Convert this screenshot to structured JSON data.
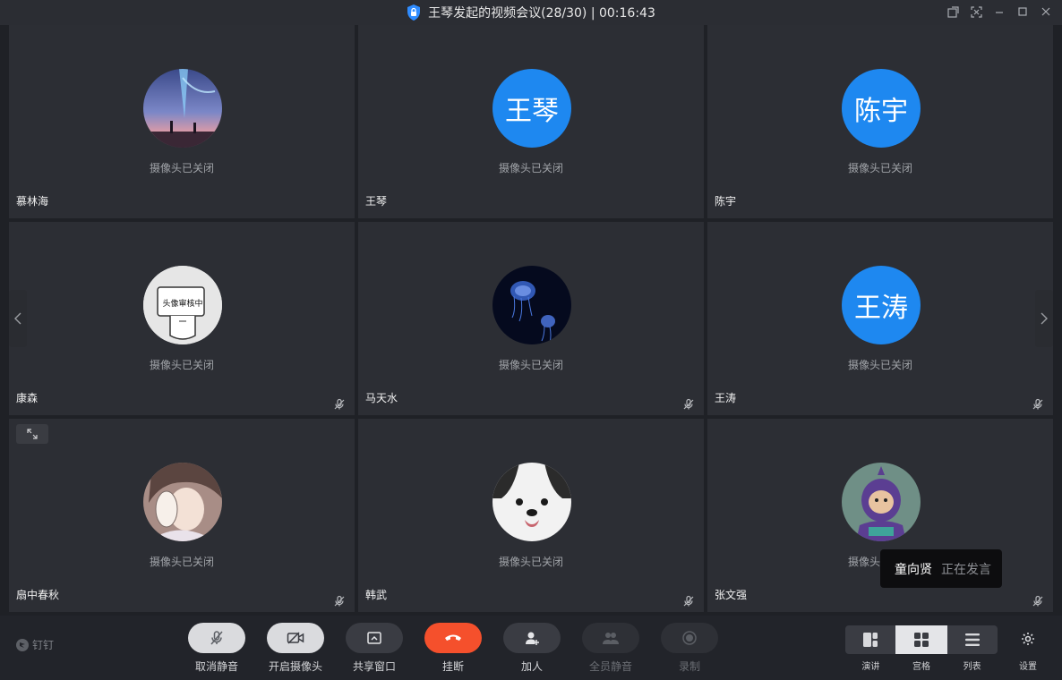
{
  "window": {
    "title": "王琴发起的视频会议(28/30) | 00:16:43"
  },
  "participants": [
    {
      "name": "慕林海",
      "camera_status": "摄像头已关闭",
      "avatar_type": "image",
      "avatar_desc": "anime-sky-avatar",
      "muted": false
    },
    {
      "name": "王琴",
      "camera_status": "摄像头已关闭",
      "avatar_type": "text",
      "avatar_text": "王琴",
      "muted": false
    },
    {
      "name": "陈宇",
      "camera_status": "摄像头已关闭",
      "avatar_type": "text",
      "avatar_text": "陈宇",
      "muted": false
    },
    {
      "name": "康森",
      "camera_status": "摄像头已关闭",
      "avatar_type": "image",
      "avatar_desc": "review-pending-avatar",
      "avatar_overlay": "头像审核中",
      "muted": true
    },
    {
      "name": "马天水",
      "camera_status": "摄像头已关闭",
      "avatar_type": "image",
      "avatar_desc": "jellyfish-avatar",
      "muted": true
    },
    {
      "name": "王涛",
      "camera_status": "摄像头已关闭",
      "avatar_type": "text",
      "avatar_text": "王涛",
      "muted": true
    },
    {
      "name": "扇中春秋",
      "camera_status": "摄像头已关闭",
      "avatar_type": "image",
      "avatar_desc": "anime-character-avatar",
      "muted": true
    },
    {
      "name": "韩武",
      "camera_status": "摄像头已关闭",
      "avatar_type": "image",
      "avatar_desc": "puppy-avatar",
      "muted": true
    },
    {
      "name": "张文强",
      "camera_status": "摄像头已关闭",
      "avatar_type": "image",
      "avatar_desc": "teletubby-avatar",
      "muted": true
    }
  ],
  "speaking": {
    "name": "童向贤",
    "status": "正在发言"
  },
  "toolbar": {
    "brand": "钉钉",
    "buttons": [
      {
        "label": "取消静音",
        "icon": "mic-muted-icon",
        "style": "light"
      },
      {
        "label": "开启摄像头",
        "icon": "camera-off-icon",
        "style": "light"
      },
      {
        "label": "共享窗口",
        "icon": "share-window-icon",
        "style": "normal"
      },
      {
        "label": "挂断",
        "icon": "hang-up-icon",
        "style": "red"
      },
      {
        "label": "加人",
        "icon": "add-person-icon",
        "style": "normal"
      },
      {
        "label": "全员静音",
        "icon": "mute-all-icon",
        "style": "dim"
      },
      {
        "label": "录制",
        "icon": "record-icon",
        "style": "dim"
      }
    ],
    "layouts": [
      {
        "label": "演讲",
        "active": false
      },
      {
        "label": "宫格",
        "active": true
      },
      {
        "label": "列表",
        "active": false
      }
    ],
    "settings_label": "设置"
  },
  "colors": {
    "accent_blue": "#1e88f0",
    "hangup_red": "#f5502c",
    "tile_bg": "#2c2e34"
  }
}
